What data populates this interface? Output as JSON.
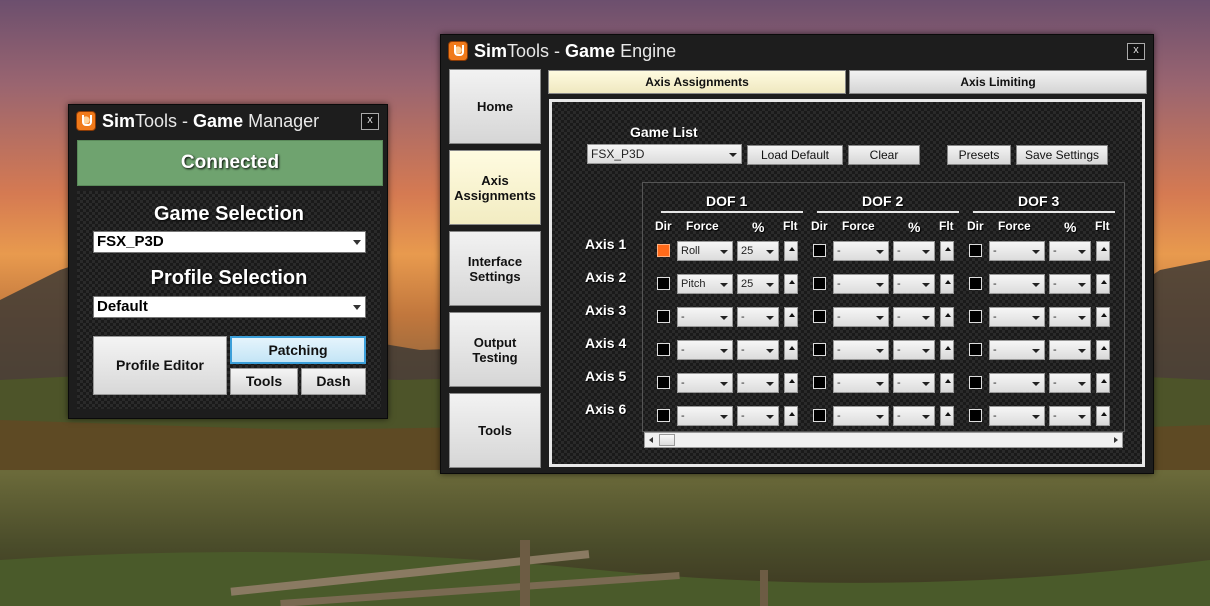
{
  "game_manager": {
    "title_brand": "Sim",
    "title_rest": "Tools - ",
    "title_bold": "Game",
    "title_tail": " Manager",
    "close": "x",
    "status": "Connected",
    "game_selection_label": "Game Selection",
    "game_selection_value": "FSX_P3D",
    "profile_selection_label": "Profile Selection",
    "profile_selection_value": "Default",
    "buttons": {
      "profile_editor": "Profile Editor",
      "patching": "Patching",
      "tools": "Tools",
      "dash": "Dash"
    },
    "colors": {
      "status_bg": "#6fa36f",
      "patching_border": "#3c9fd9"
    }
  },
  "game_engine": {
    "title_brand": "Sim",
    "title_rest": "Tools - ",
    "title_bold": "Game",
    "title_tail": " Engine",
    "close": "x",
    "sidebar": [
      {
        "label": "Home"
      },
      {
        "label": "Axis Assignments"
      },
      {
        "label": "Interface Settings"
      },
      {
        "label": "Output Testing"
      },
      {
        "label": "Tools"
      }
    ],
    "tabs": [
      {
        "label": "Axis Assignments"
      },
      {
        "label": "Axis Limiting"
      }
    ],
    "game_list_label": "Game List",
    "game_list_value": "FSX_P3D",
    "buttons": {
      "load_default": "Load Default",
      "clear": "Clear",
      "presets": "Presets",
      "save_settings": "Save Settings"
    },
    "dof_headers": [
      "DOF 1",
      "DOF 2",
      "DOF 3"
    ],
    "col_headers": {
      "dir": "Dir",
      "force": "Force",
      "pct": "%",
      "flt": "Flt"
    },
    "axes": [
      {
        "label": "Axis 1",
        "dof": [
          {
            "dir": true,
            "force": "Roll",
            "pct": "25"
          },
          {
            "dir": false,
            "force": "-",
            "pct": "-"
          },
          {
            "dir": false,
            "force": "-",
            "pct": "-"
          }
        ]
      },
      {
        "label": "Axis 2",
        "dof": [
          {
            "dir": false,
            "force": "Pitch",
            "pct": "25"
          },
          {
            "dir": false,
            "force": "-",
            "pct": "-"
          },
          {
            "dir": false,
            "force": "-",
            "pct": "-"
          }
        ]
      },
      {
        "label": "Axis 3",
        "dof": [
          {
            "dir": false,
            "force": "-",
            "pct": "-"
          },
          {
            "dir": false,
            "force": "-",
            "pct": "-"
          },
          {
            "dir": false,
            "force": "-",
            "pct": "-"
          }
        ]
      },
      {
        "label": "Axis 4",
        "dof": [
          {
            "dir": false,
            "force": "-",
            "pct": "-"
          },
          {
            "dir": false,
            "force": "-",
            "pct": "-"
          },
          {
            "dir": false,
            "force": "-",
            "pct": "-"
          }
        ]
      },
      {
        "label": "Axis 5",
        "dof": [
          {
            "dir": false,
            "force": "-",
            "pct": "-"
          },
          {
            "dir": false,
            "force": "-",
            "pct": "-"
          },
          {
            "dir": false,
            "force": "-",
            "pct": "-"
          }
        ]
      },
      {
        "label": "Axis 6",
        "dof": [
          {
            "dir": false,
            "force": "-",
            "pct": "-"
          },
          {
            "dir": false,
            "force": "-",
            "pct": "-"
          },
          {
            "dir": false,
            "force": "-",
            "pct": "-"
          }
        ]
      }
    ],
    "colors": {
      "dir_checked": "#ff6a1a",
      "active_tab": "#fffbe0"
    }
  }
}
